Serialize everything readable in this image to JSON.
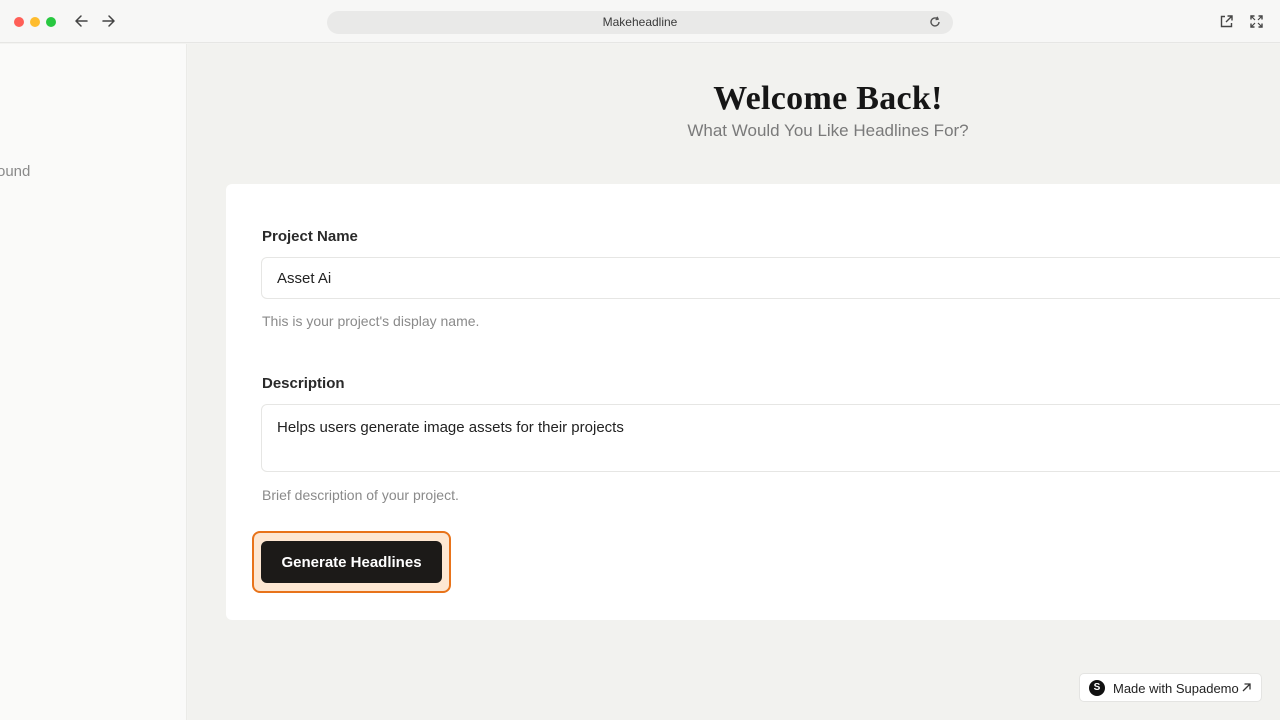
{
  "browser": {
    "url_title": "Makeheadline",
    "icons": [
      "back-arrow-icon",
      "forward-arrow-icon",
      "reload-icon",
      "open-external-icon",
      "fullscreen-icon"
    ]
  },
  "sidebar": {
    "partial_text": "ts Found"
  },
  "main": {
    "heading": "Welcome Back!",
    "subheading": "What Would You Like Headlines For?"
  },
  "form": {
    "project_name_label": "Project Name",
    "project_name_value": "Asset Ai",
    "project_name_help": "This is your project's display name.",
    "description_label": "Description",
    "description_value": "Helps users generate image assets for their projects",
    "description_help": "Brief description of your project.",
    "submit_label": "Generate Headlines",
    "focus_ring_color": "#e8731a"
  },
  "badge": {
    "logo_letter": "S",
    "text": "Made with Supademo"
  }
}
